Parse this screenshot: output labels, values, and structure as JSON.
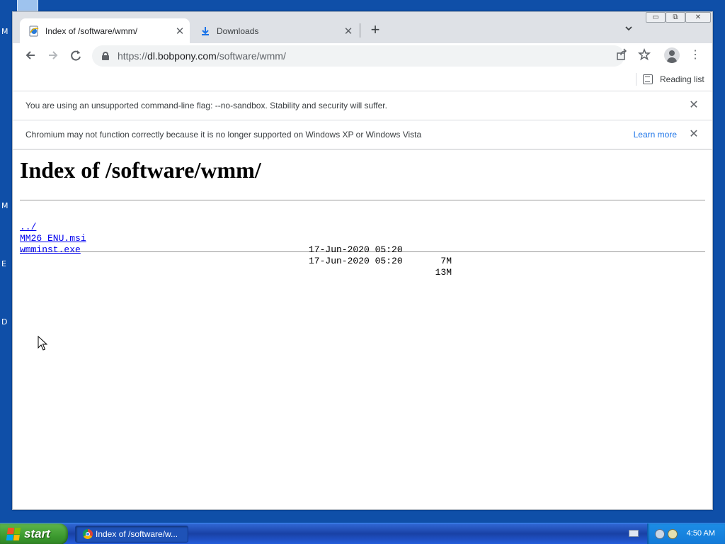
{
  "desktop": {
    "fragments": [
      "M",
      "M",
      "E",
      "D"
    ]
  },
  "browser": {
    "tabs": [
      {
        "title": "Index of /software/wmm/",
        "active": true
      },
      {
        "title": "Downloads",
        "active": false
      }
    ],
    "window_controls": {
      "minimize": "▭",
      "restore": "⧉",
      "close": "✕"
    },
    "address": {
      "scheme": "https://",
      "host": "dl.bobpony.com",
      "path": "/software/wmm/"
    },
    "bookmarks_bar": {
      "reading_list": "Reading list"
    },
    "infobars": [
      {
        "message": "You are using an unsupported command-line flag: --no-sandbox. Stability and security will suffer.",
        "link": ""
      },
      {
        "message": "Chromium may not function correctly because it is no longer supported on Windows XP or Windows Vista",
        "link": "Learn more"
      }
    ]
  },
  "page": {
    "heading": "Index of /software/wmm/",
    "entries": [
      {
        "name": "../",
        "date": "",
        "size": ""
      },
      {
        "name": "MM26_ENU.msi",
        "date": "17-Jun-2020 05:20",
        "size": "7M"
      },
      {
        "name": "wmminst.exe",
        "date": "17-Jun-2020 05:20",
        "size": "13M"
      }
    ]
  },
  "taskbar": {
    "start_label": "start",
    "task_button": "Index of /software/w...",
    "clock": "4:50 AM"
  },
  "colors": {
    "desktop": "#0f4fa8",
    "link": "#0000ee",
    "accent": "#1a73e8"
  }
}
